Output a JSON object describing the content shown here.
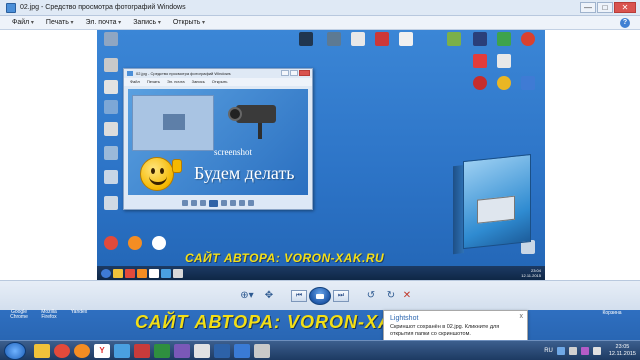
{
  "window": {
    "title": "02.jpg - Средство просмотра фотографий Windows",
    "minimize": "—",
    "maximize": "□",
    "close": "✕"
  },
  "menu": {
    "items": [
      "Файл",
      "Печать",
      "Эл. почта",
      "Запись",
      "Открыть"
    ],
    "help": "?"
  },
  "image": {
    "inner_window_title": "02.jpg - Средство просмотра фотографий Windows",
    "inner_menu": [
      "Файл",
      "Печать",
      "Эл. почта",
      "Запись",
      "Открыть"
    ],
    "screenshot_word": "screenshot",
    "caption": "Будем делать",
    "inner_banner": "САЙТ АВТОРА:  VORON-XAK.RU",
    "inner_clock": "23:04",
    "inner_date": "12.11.2015"
  },
  "viewer_toolbar": {
    "zoom": "⊕▾",
    "fit": "✥",
    "prev": "⏮",
    "next": "⏭",
    "rotate_left": "↺",
    "rotate_right": "↻",
    "delete": "✕"
  },
  "desktop": {
    "icons": [
      "Google Chrome",
      "Mozilla Firefox",
      "Yandex"
    ],
    "banner": "САЙТ АВТОРА:  VORON-XAK.RU",
    "right_icon": "Корзина"
  },
  "notification": {
    "title": "Lightshot",
    "body": "Скриншот сохранён в 02.jpg. Кликните для открытия папки со скриншотом.",
    "close": "x"
  },
  "taskbar": {
    "language": "RU",
    "time": "23:05",
    "date": "12.11.2015",
    "yandex_letter": "Y"
  },
  "colors": {
    "desktop_blue": "#2f6fc0",
    "banner_yellow": "#f3df16",
    "close_red": "#d9534f"
  }
}
